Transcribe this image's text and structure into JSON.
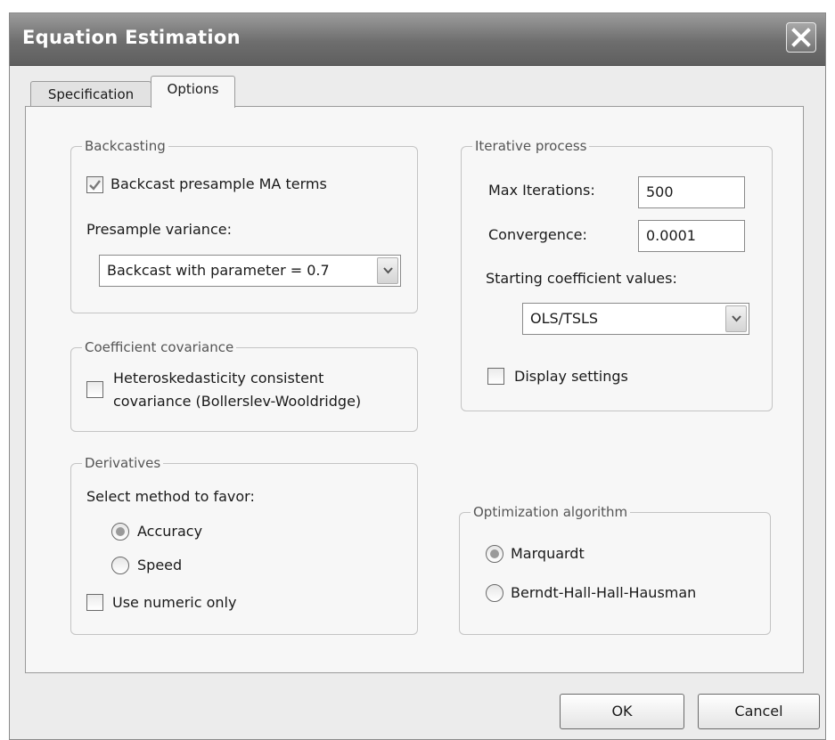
{
  "window": {
    "title": "Equation Estimation"
  },
  "tabs": [
    {
      "label": "Specification",
      "active": false
    },
    {
      "label": "Options",
      "active": true
    }
  ],
  "backcasting": {
    "legend": "Backcasting",
    "checkbox_label": "Backcast presample MA terms",
    "checked": true,
    "variance_label": "Presample variance:",
    "variance_value": "Backcast with parameter = 0.7"
  },
  "coefficient_covariance": {
    "legend": "Coefficient covariance",
    "checkbox_line1": "Heteroskedasticity consistent",
    "checkbox_line2": "covariance (Bollerslev-Wooldridge)",
    "checked": false
  },
  "derivatives": {
    "legend": "Derivatives",
    "prompt": "Select method to favor:",
    "options": [
      {
        "label": "Accuracy",
        "selected": true
      },
      {
        "label": "Speed",
        "selected": false
      }
    ],
    "numeric_only_label": "Use numeric only",
    "numeric_only_checked": false
  },
  "iterative": {
    "legend": "Iterative process",
    "max_iter_label": "Max Iterations:",
    "max_iter_value": "500",
    "convergence_label": "Convergence:",
    "convergence_value": "0.0001",
    "starting_label": "Starting coefficient values:",
    "starting_value": "OLS/TSLS",
    "display_label": "Display settings",
    "display_checked": false
  },
  "optimization": {
    "legend": "Optimization algorithm",
    "options": [
      {
        "label": "Marquardt",
        "selected": true
      },
      {
        "label": "Berndt-Hall-Hall-Hausman",
        "selected": false
      }
    ]
  },
  "buttons": {
    "ok": "OK",
    "cancel": "Cancel"
  },
  "icons": {
    "close": "close-icon",
    "dropdown": "chevron-down-icon",
    "check": "checkmark-icon"
  },
  "colors": {
    "titlebar": "#6e6e6e",
    "dialog_bg": "#ececec",
    "panel_bg": "#f7f7f7",
    "selected_radio": "#9a9a9a"
  }
}
